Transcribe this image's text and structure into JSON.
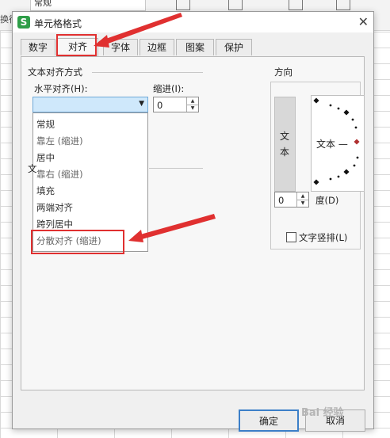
{
  "background": {
    "namebox": "常规",
    "left_label": "换行"
  },
  "dialog": {
    "app_icon": "S",
    "title": "单元格格式",
    "close_icon": "✕"
  },
  "tabs": [
    "数字",
    "对齐",
    "字体",
    "边框",
    "图案",
    "保护"
  ],
  "active_tab": "对齐",
  "alignment_group": {
    "title": "文本对齐方式",
    "horizontal_label": "水平对齐(H):",
    "horizontal_value": ""
  },
  "indent": {
    "label": "缩进(I):",
    "value": "0"
  },
  "dropdown_options": [
    "常规",
    "靠左 (缩进)",
    "居中",
    "靠右 (缩进)",
    "填充",
    "两端对齐",
    "跨列居中",
    "分散对齐 (缩进)"
  ],
  "hidden_group_initial": "文",
  "orientation": {
    "title": "方向",
    "vertical_text": [
      "文",
      "本"
    ],
    "dial_text": "文本 —",
    "degrees_value": "0",
    "degrees_label": "度(D)",
    "vertical_stack_label": "文字竖排(L)"
  },
  "buttons": {
    "ok": "确定",
    "cancel": "取消"
  },
  "watermark": "Bai 经验",
  "colors": {
    "accent": "#e03030",
    "selection": "#cfe8fb",
    "app_icon": "#2e9e48",
    "ok_border": "#3c7fc8"
  }
}
